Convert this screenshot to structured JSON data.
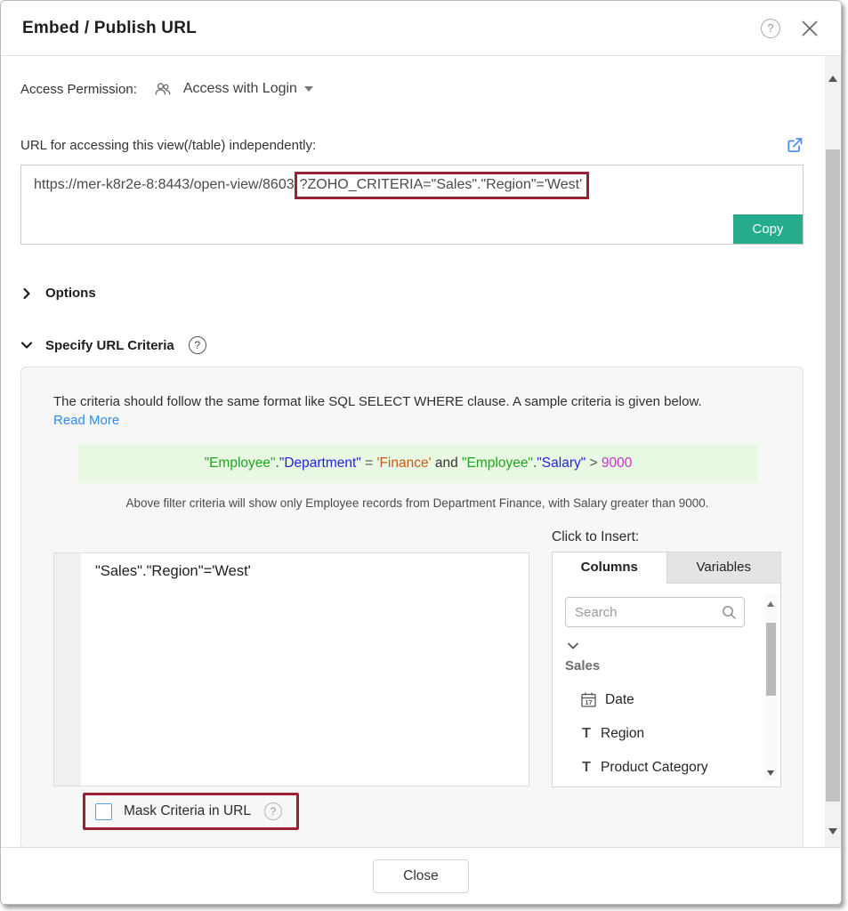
{
  "icons": {
    "help_glyph": "?",
    "calendar_day": "17",
    "text_type_glyph": "T"
  },
  "colors": {
    "accent_teal": "#27ab8d",
    "annotation_red": "#9a2033",
    "link_blue": "#2f8be6",
    "external_icon_blue": "#4186f5",
    "checkbox_blue": "#53a3e8",
    "sample_bg_green": "#e9f8e3"
  },
  "dialog": {
    "title": "Embed / Publish URL",
    "access": {
      "label": "Access Permission:",
      "value": "Access with Login"
    },
    "url_section": {
      "label": "URL for accessing this view(/table) independently:",
      "url_prefix": "https://mer-k8r2e-8:8443/open-view/8603",
      "url_highlighted": "?ZOHO_CRITERIA=\"Sales\".\"Region\"='West'",
      "copy_button": "Copy"
    },
    "options": {
      "label": "Options"
    },
    "criteria": {
      "label": "Specify URL Criteria",
      "intro": "The criteria should follow the same format like SQL SELECT WHERE clause. A sample criteria is given below.",
      "read_more": "Read More",
      "sample_tokens": [
        {
          "text": "\"Employee\"",
          "color": "#1fa41f"
        },
        {
          "text": ".",
          "color": "#333333"
        },
        {
          "text": "\"Department\"",
          "color": "#2323dd"
        },
        {
          "text": " = ",
          "color": "#555555"
        },
        {
          "text": "'Finance'",
          "color": "#c55a11"
        },
        {
          "text": " and ",
          "color": "#333333"
        },
        {
          "text": "\"Employee\"",
          "color": "#1fa41f"
        },
        {
          "text": ".",
          "color": "#333333"
        },
        {
          "text": "\"Salary\"",
          "color": "#2323dd"
        },
        {
          "text": " > ",
          "color": "#555555"
        },
        {
          "text": "9000",
          "color": "#cc2fcc"
        }
      ],
      "sample_caption": "Above filter criteria will show only Employee records from Department Finance, with Salary greater than 9000.",
      "editor_value": "\"Sales\".\"Region\"='West'",
      "click_to_insert": "Click to Insert:",
      "tabs": {
        "columns": "Columns",
        "variables": "Variables"
      },
      "search_placeholder": "Search",
      "tree": {
        "table": "Sales",
        "columns": [
          {
            "name": "Date",
            "type": "date"
          },
          {
            "name": "Region",
            "type": "text"
          },
          {
            "name": "Product Category",
            "type": "text"
          }
        ]
      },
      "mask_label": "Mask Criteria in URL"
    },
    "footer": {
      "close_button": "Close"
    }
  }
}
